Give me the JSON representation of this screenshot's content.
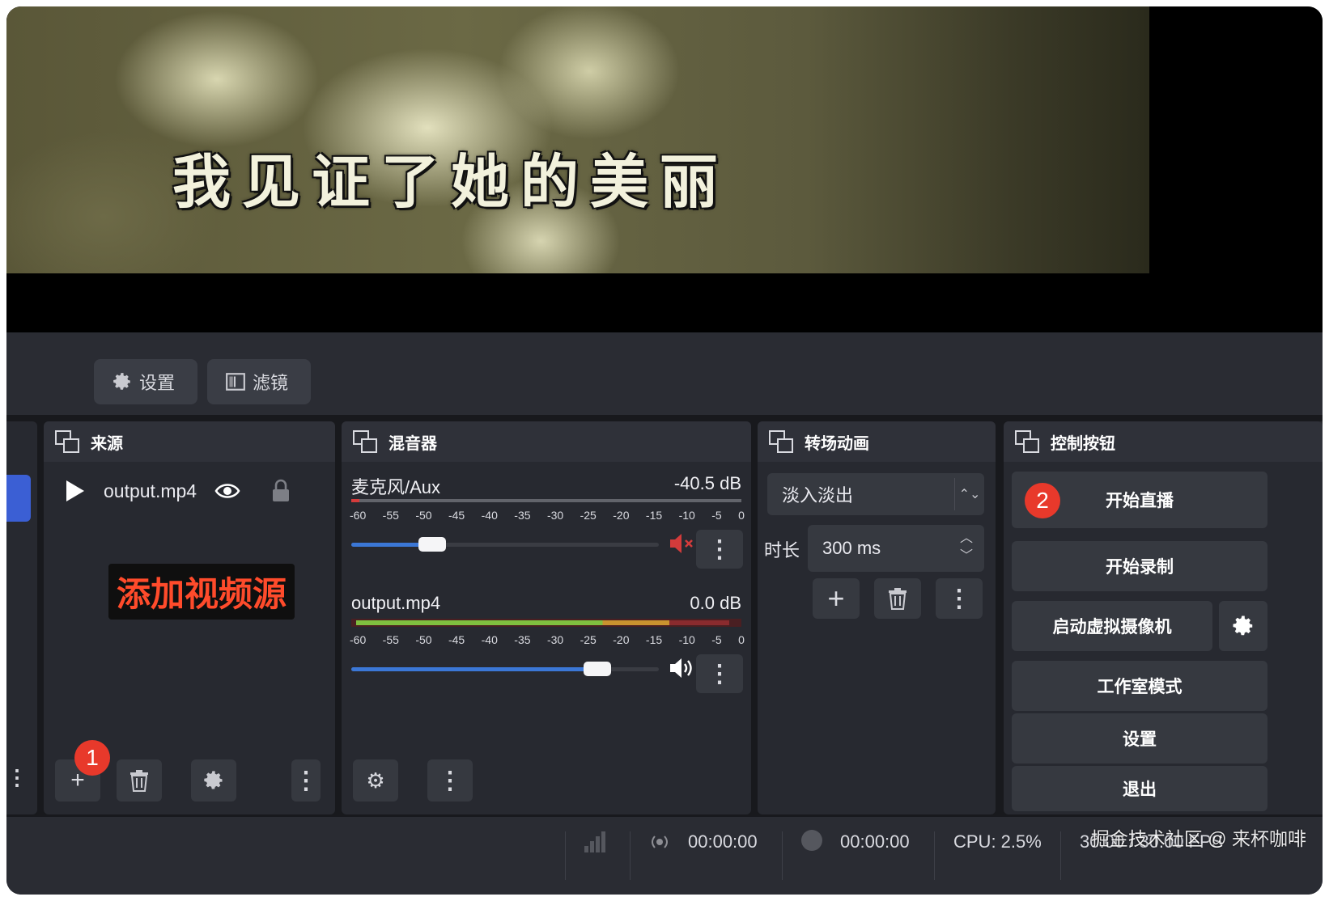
{
  "preview": {
    "subtitle": "我见证了她的美丽"
  },
  "toolbar": {
    "settings_label": "设置",
    "filters_label": "滤镜"
  },
  "sources": {
    "title": "来源",
    "items": [
      {
        "name": "output.mp4",
        "icon": "play-icon"
      }
    ],
    "callout": "添加视频源",
    "add_badge": "1"
  },
  "mixer": {
    "title": "混音器",
    "ticks": [
      "-60",
      "-55",
      "-50",
      "-45",
      "-40",
      "-35",
      "-30",
      "-25",
      "-20",
      "-15",
      "-10",
      "-5",
      "0"
    ],
    "channels": [
      {
        "name": "麦克风/Aux",
        "db": "-40.5 dB",
        "volume": 0.24,
        "level": 0.02,
        "muted": true
      },
      {
        "name": "output.mp4",
        "db": "0.0 dB",
        "volume": 0.83,
        "level": 0.98,
        "muted": false
      }
    ]
  },
  "transitions": {
    "title": "转场动画",
    "selected": "淡入淡出",
    "duration_label": "时长",
    "duration_value": "300 ms"
  },
  "controls": {
    "title": "控制按钮",
    "badge": "2",
    "start_stream": "开始直播",
    "start_record": "开始录制",
    "virtual_cam": "启动虚拟摄像机",
    "studio_mode": "工作室模式",
    "settings": "设置",
    "exit": "退出"
  },
  "status": {
    "stream_time": "00:00:00",
    "record_time": "00:00:00",
    "cpu": "CPU: 2.5%",
    "fps": "30.00 / 30.00 FPS",
    "watermark": "掘金技术社区 @ 来杯咖啡"
  },
  "colors": {
    "accent_blue": "#3b77d6",
    "badge_red": "#e8392b",
    "callout_red": "#ff4b2b",
    "mute_red": "#d43b3b"
  }
}
